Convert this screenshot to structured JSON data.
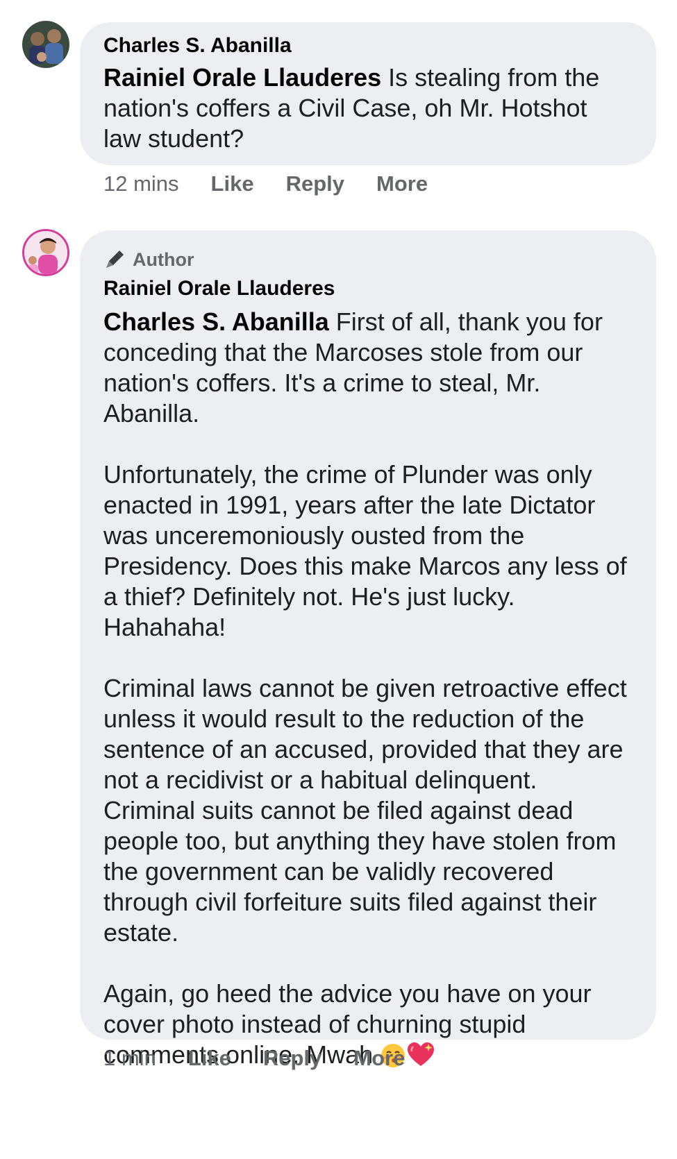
{
  "comments": [
    {
      "author": "Charles S. Abanilla",
      "badge": "",
      "mention": "Rainiel Orale Llauderes",
      "body": " Is stealing from the nation's coffers a Civil Case, oh Mr. Hotshot law student?",
      "time": "12 mins",
      "actions": {
        "like": "Like",
        "reply": "Reply",
        "more": "More"
      }
    },
    {
      "author": "Rainiel Orale Llauderes",
      "badge": "Author",
      "mention": "Charles S. Abanilla",
      "body": " First of all, thank you for conceding that the Marcoses stole from our nation's coffers. It's a crime to steal, Mr. Abanilla.\n\nUnfortunately, the crime of Plunder was only enacted in 1991, years after the late Dictator was unceremoniously ousted from the Presidency. Does this make Marcos any less of a thief? Definitely not. He's just lucky. Hahahaha!\n\nCriminal laws cannot be given retroactive effect unless it would result to the reduction of the sentence of an accused, provided that they are not a recidivist or a habitual delinquent. Criminal suits cannot be filed against dead people too, but anything they have stolen from the government can be validly recovered through civil forfeiture suits filed against their estate.\n\nAgain, go heed the advice you have on your cover photo instead of churning stupid comments online. Mwah ",
      "emojis": [
        "kissing-face-emoji",
        "sparkling-heart-emoji"
      ],
      "time": "1 min",
      "actions": {
        "like": "Like",
        "reply": "Reply",
        "more": "More"
      }
    }
  ]
}
